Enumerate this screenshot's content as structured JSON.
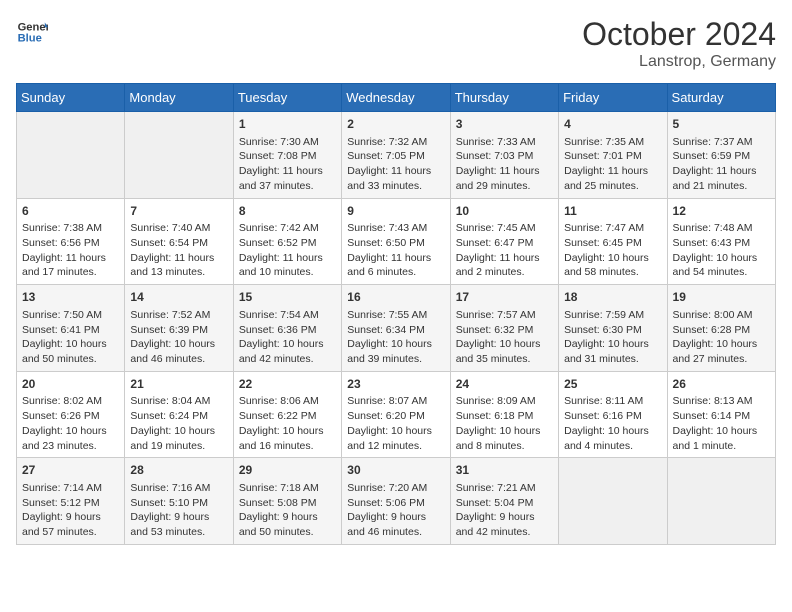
{
  "header": {
    "logo_line1": "General",
    "logo_line2": "Blue",
    "month": "October 2024",
    "location": "Lanstrop, Germany"
  },
  "weekdays": [
    "Sunday",
    "Monday",
    "Tuesday",
    "Wednesday",
    "Thursday",
    "Friday",
    "Saturday"
  ],
  "weeks": [
    [
      {
        "day": "",
        "text": ""
      },
      {
        "day": "",
        "text": ""
      },
      {
        "day": "1",
        "text": "Sunrise: 7:30 AM\nSunset: 7:08 PM\nDaylight: 11 hours\nand 37 minutes."
      },
      {
        "day": "2",
        "text": "Sunrise: 7:32 AM\nSunset: 7:05 PM\nDaylight: 11 hours\nand 33 minutes."
      },
      {
        "day": "3",
        "text": "Sunrise: 7:33 AM\nSunset: 7:03 PM\nDaylight: 11 hours\nand 29 minutes."
      },
      {
        "day": "4",
        "text": "Sunrise: 7:35 AM\nSunset: 7:01 PM\nDaylight: 11 hours\nand 25 minutes."
      },
      {
        "day": "5",
        "text": "Sunrise: 7:37 AM\nSunset: 6:59 PM\nDaylight: 11 hours\nand 21 minutes."
      }
    ],
    [
      {
        "day": "6",
        "text": "Sunrise: 7:38 AM\nSunset: 6:56 PM\nDaylight: 11 hours\nand 17 minutes."
      },
      {
        "day": "7",
        "text": "Sunrise: 7:40 AM\nSunset: 6:54 PM\nDaylight: 11 hours\nand 13 minutes."
      },
      {
        "day": "8",
        "text": "Sunrise: 7:42 AM\nSunset: 6:52 PM\nDaylight: 11 hours\nand 10 minutes."
      },
      {
        "day": "9",
        "text": "Sunrise: 7:43 AM\nSunset: 6:50 PM\nDaylight: 11 hours\nand 6 minutes."
      },
      {
        "day": "10",
        "text": "Sunrise: 7:45 AM\nSunset: 6:47 PM\nDaylight: 11 hours\nand 2 minutes."
      },
      {
        "day": "11",
        "text": "Sunrise: 7:47 AM\nSunset: 6:45 PM\nDaylight: 10 hours\nand 58 minutes."
      },
      {
        "day": "12",
        "text": "Sunrise: 7:48 AM\nSunset: 6:43 PM\nDaylight: 10 hours\nand 54 minutes."
      }
    ],
    [
      {
        "day": "13",
        "text": "Sunrise: 7:50 AM\nSunset: 6:41 PM\nDaylight: 10 hours\nand 50 minutes."
      },
      {
        "day": "14",
        "text": "Sunrise: 7:52 AM\nSunset: 6:39 PM\nDaylight: 10 hours\nand 46 minutes."
      },
      {
        "day": "15",
        "text": "Sunrise: 7:54 AM\nSunset: 6:36 PM\nDaylight: 10 hours\nand 42 minutes."
      },
      {
        "day": "16",
        "text": "Sunrise: 7:55 AM\nSunset: 6:34 PM\nDaylight: 10 hours\nand 39 minutes."
      },
      {
        "day": "17",
        "text": "Sunrise: 7:57 AM\nSunset: 6:32 PM\nDaylight: 10 hours\nand 35 minutes."
      },
      {
        "day": "18",
        "text": "Sunrise: 7:59 AM\nSunset: 6:30 PM\nDaylight: 10 hours\nand 31 minutes."
      },
      {
        "day": "19",
        "text": "Sunrise: 8:00 AM\nSunset: 6:28 PM\nDaylight: 10 hours\nand 27 minutes."
      }
    ],
    [
      {
        "day": "20",
        "text": "Sunrise: 8:02 AM\nSunset: 6:26 PM\nDaylight: 10 hours\nand 23 minutes."
      },
      {
        "day": "21",
        "text": "Sunrise: 8:04 AM\nSunset: 6:24 PM\nDaylight: 10 hours\nand 19 minutes."
      },
      {
        "day": "22",
        "text": "Sunrise: 8:06 AM\nSunset: 6:22 PM\nDaylight: 10 hours\nand 16 minutes."
      },
      {
        "day": "23",
        "text": "Sunrise: 8:07 AM\nSunset: 6:20 PM\nDaylight: 10 hours\nand 12 minutes."
      },
      {
        "day": "24",
        "text": "Sunrise: 8:09 AM\nSunset: 6:18 PM\nDaylight: 10 hours\nand 8 minutes."
      },
      {
        "day": "25",
        "text": "Sunrise: 8:11 AM\nSunset: 6:16 PM\nDaylight: 10 hours\nand 4 minutes."
      },
      {
        "day": "26",
        "text": "Sunrise: 8:13 AM\nSunset: 6:14 PM\nDaylight: 10 hours\nand 1 minute."
      }
    ],
    [
      {
        "day": "27",
        "text": "Sunrise: 7:14 AM\nSunset: 5:12 PM\nDaylight: 9 hours\nand 57 minutes."
      },
      {
        "day": "28",
        "text": "Sunrise: 7:16 AM\nSunset: 5:10 PM\nDaylight: 9 hours\nand 53 minutes."
      },
      {
        "day": "29",
        "text": "Sunrise: 7:18 AM\nSunset: 5:08 PM\nDaylight: 9 hours\nand 50 minutes."
      },
      {
        "day": "30",
        "text": "Sunrise: 7:20 AM\nSunset: 5:06 PM\nDaylight: 9 hours\nand 46 minutes."
      },
      {
        "day": "31",
        "text": "Sunrise: 7:21 AM\nSunset: 5:04 PM\nDaylight: 9 hours\nand 42 minutes."
      },
      {
        "day": "",
        "text": ""
      },
      {
        "day": "",
        "text": ""
      }
    ]
  ]
}
